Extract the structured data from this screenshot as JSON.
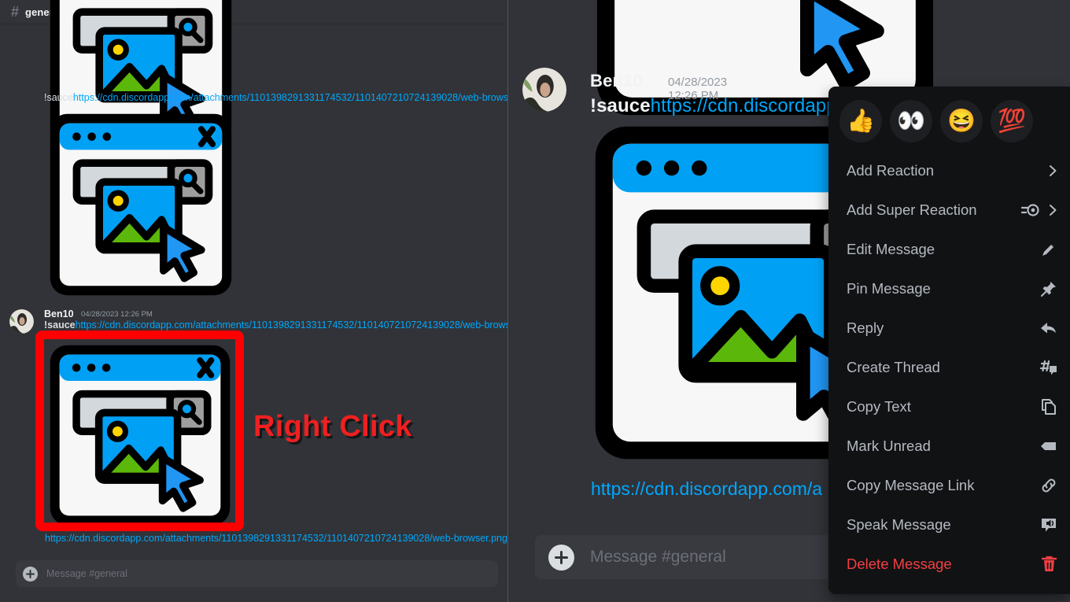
{
  "channel": {
    "hash_icon": "hash-icon",
    "name": "general"
  },
  "left_panel": {
    "link_top": {
      "prefix": "!sauce",
      "url": "https://cdn.discordapp.com/attachments/1101398291331174532/1101407210724139028/web-browser.p"
    },
    "message": {
      "username": "Ben10",
      "timestamp": "04/28/2023 12:26 PM",
      "prefix": "!sauce",
      "url": "https://cdn.discordapp.com/attachments/1101398291331174532/1101407210724139028/web-browser.p"
    },
    "attachment_link": "https://cdn.discordapp.com/attachments/1101398291331174532/1101407210724139028/web-browser.png!sau",
    "annotation": "Right Click",
    "annotation_color": "#ee2020",
    "composer_placeholder": "Message #general",
    "plus_icon": "plus-icon"
  },
  "right_panel": {
    "message": {
      "username": "Ben10",
      "timestamp": "04/28/2023 12:26 PM",
      "prefix": "!sauce",
      "url": "https://cdn.discordapp."
    },
    "attachment_link": "https://cdn.discordapp.com/a",
    "composer_placeholder": "Message #general",
    "plus_icon": "plus-icon"
  },
  "context_menu": {
    "reactions": [
      {
        "name": "thumbs-up-emoji",
        "glyph": "👍"
      },
      {
        "name": "eyes-emoji",
        "glyph": "👀"
      },
      {
        "name": "laughing-emoji",
        "glyph": "😆"
      },
      {
        "name": "hundred-points-emoji",
        "glyph": "💯"
      }
    ],
    "items": [
      {
        "label": "Add Reaction",
        "icon": "chevron-right-icon",
        "danger": false
      },
      {
        "label": "Add Super Reaction",
        "icon": "super-reaction-icon",
        "danger": false
      },
      {
        "label": "Edit Message",
        "icon": "pencil-icon",
        "danger": false
      },
      {
        "label": "Pin Message",
        "icon": "pin-icon",
        "danger": false
      },
      {
        "label": "Reply",
        "icon": "reply-arrow-icon",
        "danger": false
      },
      {
        "label": "Create Thread",
        "icon": "thread-icon",
        "danger": false
      },
      {
        "label": "Copy Text",
        "icon": "copy-icon",
        "danger": false
      },
      {
        "label": "Mark Unread",
        "icon": "mark-unread-icon",
        "danger": false
      },
      {
        "label": "Copy Message Link",
        "icon": "link-icon",
        "danger": false
      },
      {
        "label": "Speak Message",
        "icon": "speaker-icon",
        "danger": false
      },
      {
        "label": "Delete Message",
        "icon": "trash-icon",
        "danger": true
      }
    ],
    "danger_color": "#f23f43",
    "background_color": "#111214"
  }
}
